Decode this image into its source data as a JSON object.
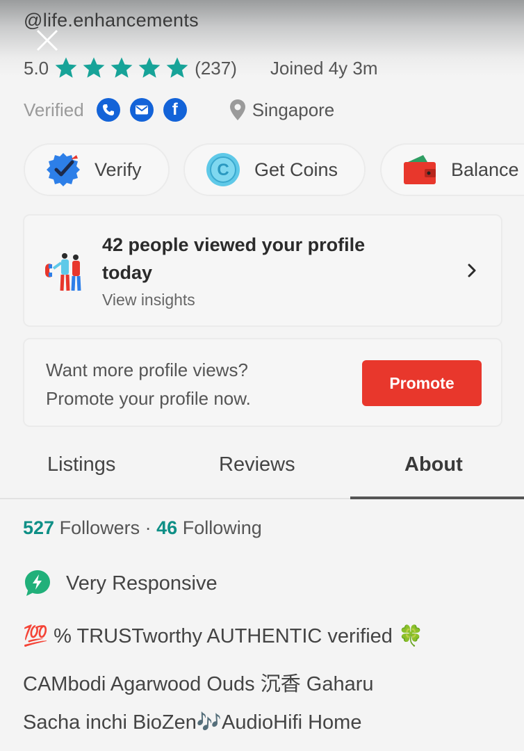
{
  "profile": {
    "handle": "@life.enhancements",
    "rating": "5.0",
    "rating_stars": 5,
    "review_count": "(237)",
    "joined": "Joined 4y 3m",
    "verified_label": "Verified",
    "verified_methods": [
      "phone-icon",
      "email-icon",
      "facebook-icon"
    ],
    "location": "Singapore"
  },
  "actions": [
    {
      "label": "Verify",
      "icon": "verify-badge-icon"
    },
    {
      "label": "Get Coins",
      "icon": "coin-icon"
    },
    {
      "label": "Balance",
      "icon": "wallet-icon"
    }
  ],
  "insights": {
    "title": "42 people viewed your profile today",
    "link": "View insights"
  },
  "promo": {
    "line1": "Want more profile views?",
    "line2": "Promote your profile now.",
    "button": "Promote"
  },
  "tabs": [
    {
      "label": "Listings",
      "active": false
    },
    {
      "label": "Reviews",
      "active": false
    },
    {
      "label": "About",
      "active": true
    }
  ],
  "about": {
    "followers_count": "527",
    "followers_label": "Followers",
    "separator": "·",
    "following_count": "46",
    "following_label": "Following",
    "responsiveness": "Very Responsive",
    "bio_lines": [
      "💯 % TRUSTworthy AUTHENTIC verified 🍀",
      "CAMbodi Agarwood Ouds 沉香 Gaharu",
      "Sacha inchi BioZen🎶AudioHifi Home"
    ]
  },
  "colors": {
    "accent_teal": "#0e8f86",
    "star_green": "#17a398",
    "promote_red": "#e8372c",
    "verified_blue": "#1363d8"
  }
}
